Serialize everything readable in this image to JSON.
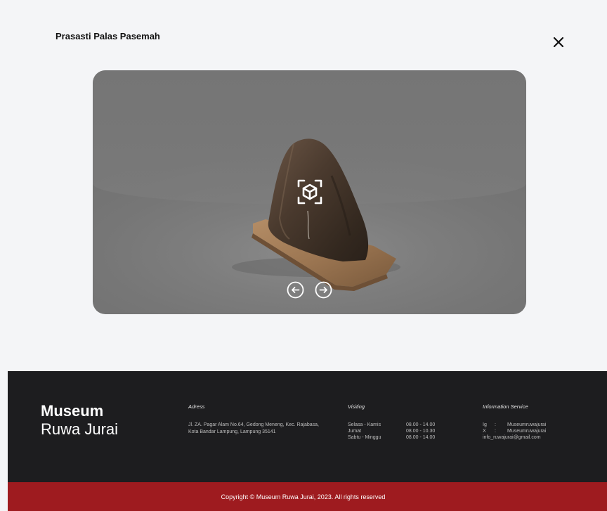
{
  "modal": {
    "title": "Prasasti Palas Pasemah"
  },
  "icons": {
    "close": "close-icon",
    "ar": "ar-cube-icon",
    "prev": "arrow-left-circle-icon",
    "next": "arrow-right-circle-icon"
  },
  "footer": {
    "brand_line1": "Museum",
    "brand_line2": "Ruwa Jurai",
    "address": {
      "heading": "Adress",
      "text": "Jl. ZA. Pagar Alam No.64, Gedong Meneng, Kec. Rajabasa, Kota Bandar Lampung, Lampung 35141"
    },
    "visiting": {
      "heading": "Visiting",
      "rows": [
        {
          "day": "Selasa - Kamis",
          "hours": "08.00 - 14.00"
        },
        {
          "day": "Jumat",
          "hours": "08.00 - 10.30"
        },
        {
          "day": "Sabtu - Minggu",
          "hours": "08.00 - 14.00"
        }
      ]
    },
    "info": {
      "heading": "Information Service",
      "rows": [
        {
          "key": "Ig",
          "sep": ":",
          "value": "Museumruwajurai"
        },
        {
          "key": "X",
          "sep": ":",
          "value": "Museumruwajurai"
        }
      ],
      "email": "info_ruwajurai@gmail.com"
    },
    "copyright": "Copyright © Museum Ruwa Jurai, 2023. All rights reserved"
  },
  "colors": {
    "footer_bg": "#1d1d1f",
    "copyright_bg": "#9e1b1f",
    "page_bg": "#f4f5f7",
    "viewer_bg": "#7a7a7a"
  }
}
